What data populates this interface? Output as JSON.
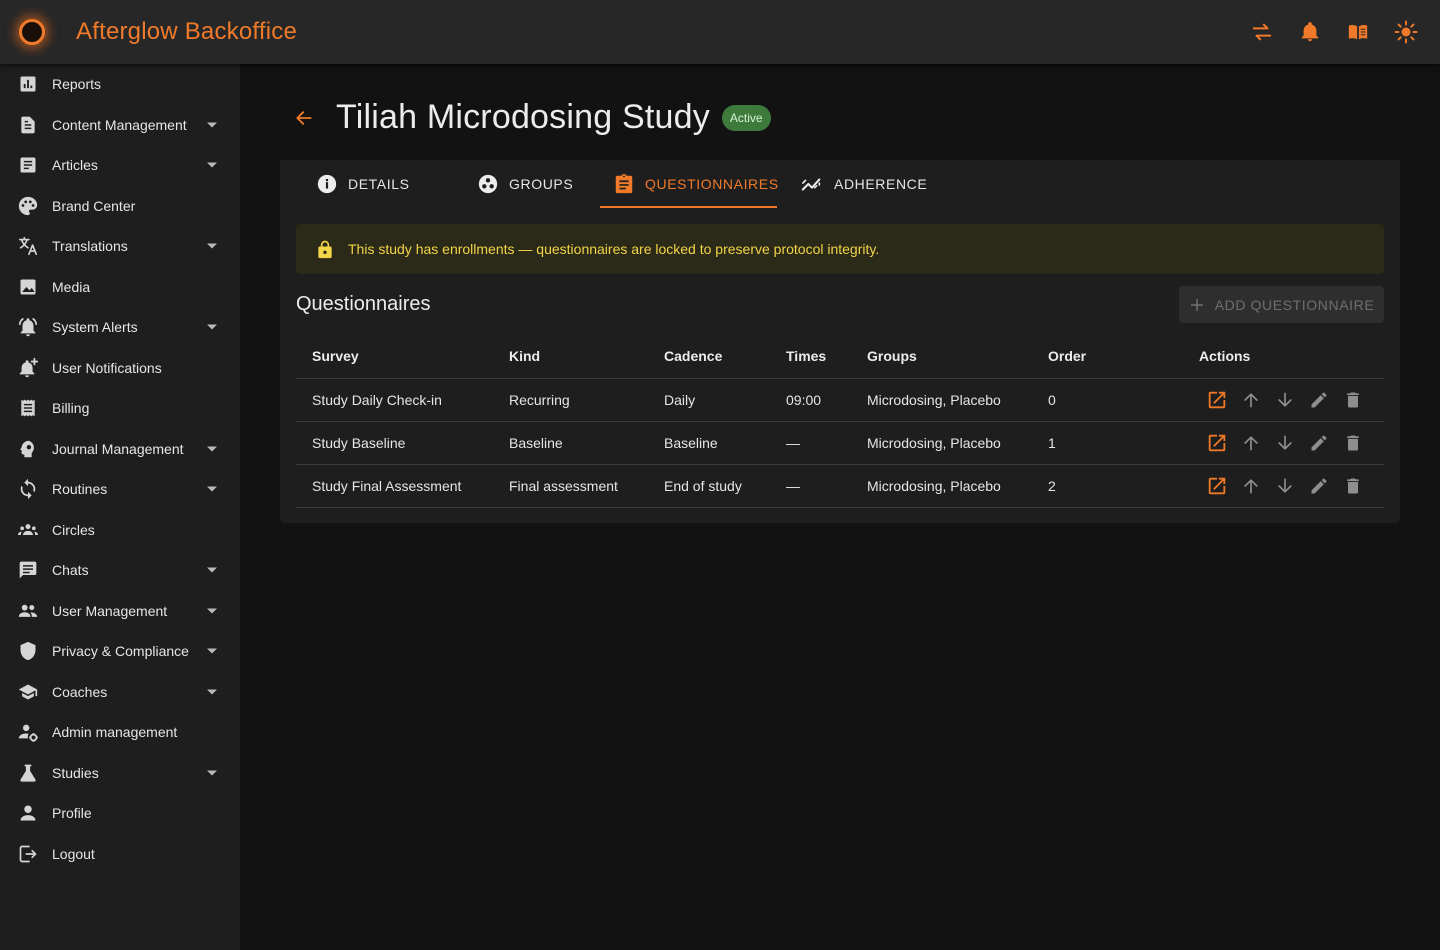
{
  "app": {
    "title": "Afterglow Backoffice",
    "accent": "#f07a2a"
  },
  "topbar": {
    "icons": [
      "swap-icon",
      "bell-icon",
      "book-open-icon",
      "sun-icon"
    ]
  },
  "sidebar": {
    "items": [
      {
        "label": "Reports",
        "icon": "bar-chart-icon",
        "expandable": false
      },
      {
        "label": "Content Management",
        "icon": "document-icon",
        "expandable": true
      },
      {
        "label": "Articles",
        "icon": "article-icon",
        "expandable": true
      },
      {
        "label": "Brand Center",
        "icon": "palette-icon",
        "expandable": false
      },
      {
        "label": "Translations",
        "icon": "translate-icon",
        "expandable": true
      },
      {
        "label": "Media",
        "icon": "image-icon",
        "expandable": false
      },
      {
        "label": "System Alerts",
        "icon": "alarm-bell-icon",
        "expandable": true
      },
      {
        "label": "User Notifications",
        "icon": "notification-add-icon",
        "expandable": false
      },
      {
        "label": "Billing",
        "icon": "receipt-icon",
        "expandable": false
      },
      {
        "label": "Journal Management",
        "icon": "psychology-icon",
        "expandable": true
      },
      {
        "label": "Routines",
        "icon": "sync-icon",
        "expandable": true
      },
      {
        "label": "Circles",
        "icon": "groups-icon",
        "expandable": false
      },
      {
        "label": "Chats",
        "icon": "chat-icon",
        "expandable": true
      },
      {
        "label": "User Management",
        "icon": "people-icon",
        "expandable": true
      },
      {
        "label": "Privacy & Compliance",
        "icon": "shield-icon",
        "expandable": true
      },
      {
        "label": "Coaches",
        "icon": "school-icon",
        "expandable": true
      },
      {
        "label": "Admin management",
        "icon": "admin-gear-icon",
        "expandable": false
      },
      {
        "label": "Studies",
        "icon": "flask-icon",
        "expandable": true
      },
      {
        "label": "Profile",
        "icon": "person-icon",
        "expandable": false
      },
      {
        "label": "Logout",
        "icon": "logout-icon",
        "expandable": false
      }
    ]
  },
  "page": {
    "title": "Tiliah Microdosing Study",
    "status": "Active",
    "tabs": [
      {
        "label": "DETAILS",
        "icon": "info-icon"
      },
      {
        "label": "GROUPS",
        "icon": "groups-circle-icon"
      },
      {
        "label": "QUESTIONNAIRES",
        "icon": "clipboard-icon"
      },
      {
        "label": "ADHERENCE",
        "icon": "trend-icon"
      }
    ],
    "active_tab": "QUESTIONNAIRES",
    "alert": "This study has enrollments — questionnaires are locked to preserve protocol integrity.",
    "section_title": "Questionnaires",
    "add_button": "ADD QUESTIONNAIRE"
  },
  "table": {
    "headers": [
      "Survey",
      "Kind",
      "Cadence",
      "Times",
      "Groups",
      "Order",
      "Actions"
    ],
    "rows": [
      [
        "Study Daily Check-in",
        "Recurring",
        "Daily",
        "09:00",
        "Microdosing, Placebo",
        "0"
      ],
      [
        "Study Baseline",
        "Baseline",
        "Baseline",
        "—",
        "Microdosing, Placebo",
        "1"
      ],
      [
        "Study Final Assessment",
        "Final assessment",
        "End of study",
        "—",
        "Microdosing, Placebo",
        "2"
      ]
    ],
    "row_actions": [
      "open-external-icon",
      "arrow-up-icon",
      "arrow-down-icon",
      "edit-pencil-icon",
      "delete-trash-icon"
    ]
  }
}
